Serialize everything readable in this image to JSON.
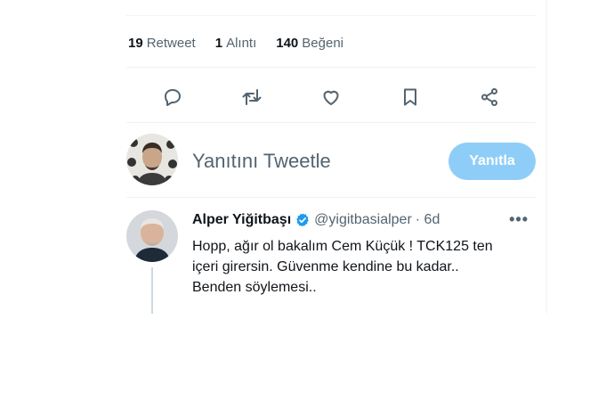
{
  "stats": [
    {
      "count": "19",
      "label": "Retweet"
    },
    {
      "count": "1",
      "label": "Alıntı"
    },
    {
      "count": "140",
      "label": "Beğeni"
    }
  ],
  "actions": [
    {
      "name": "reply",
      "icon": "reply-icon"
    },
    {
      "name": "retweet",
      "icon": "retweet-icon"
    },
    {
      "name": "like",
      "icon": "heart-icon"
    },
    {
      "name": "bookmark",
      "icon": "bookmark-icon"
    },
    {
      "name": "share",
      "icon": "share-icon"
    }
  ],
  "compose": {
    "placeholder": "Yanıtını Tweetle",
    "button_label": "Yanıtla"
  },
  "reply": {
    "author_name": "Alper Yiğitbaşı",
    "handle": "@yigitbasialper",
    "time": "· 6d",
    "more": "•••",
    "lines": [
      "Hopp, ağır ol bakalım Cem Küçük ! TCK125 ten",
      "içeri girersin. Güvenme kendine bu kadar..",
      "Benden söylemesi.."
    ]
  },
  "colors": {
    "accent_disabled": "#8ecdf8",
    "verified": "#1d9bf0",
    "muted_text": "#536471"
  }
}
